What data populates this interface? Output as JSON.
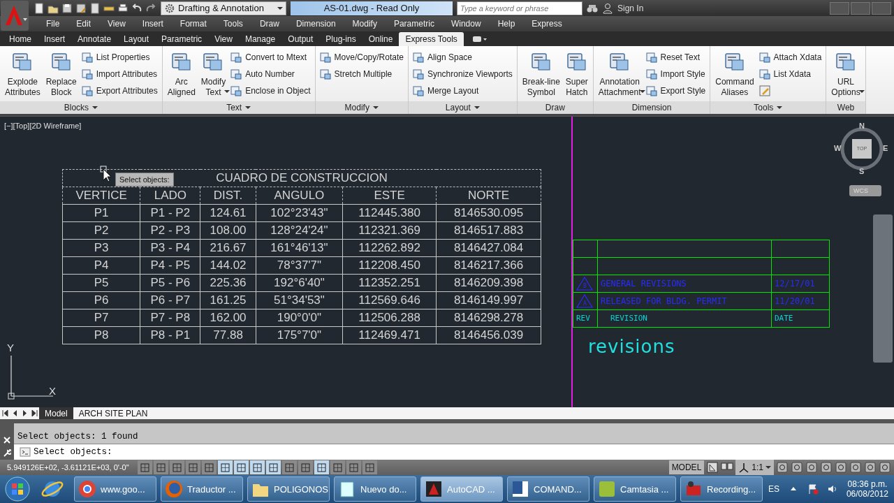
{
  "title_bar": {
    "workspace": "Drafting & Annotation",
    "title": "AS-01.dwg - Read Only",
    "search": {
      "placeholder": "Type a keyword or phrase"
    },
    "sign_in": "Sign In"
  },
  "menu": [
    "File",
    "Edit",
    "View",
    "Insert",
    "Format",
    "Tools",
    "Draw",
    "Dimension",
    "Modify",
    "Parametric",
    "Window",
    "Help",
    "Express"
  ],
  "ribbon_tabs": [
    {
      "label": "Home",
      "selected": false
    },
    {
      "label": "Insert",
      "selected": false
    },
    {
      "label": "Annotate",
      "selected": false
    },
    {
      "label": "Layout",
      "selected": false
    },
    {
      "label": "Parametric",
      "selected": false
    },
    {
      "label": "View",
      "selected": false
    },
    {
      "label": "Manage",
      "selected": false
    },
    {
      "label": "Output",
      "selected": false
    },
    {
      "label": "Plug-ins",
      "selected": false
    },
    {
      "label": "Online",
      "selected": false
    },
    {
      "label": "Express Tools",
      "selected": true
    }
  ],
  "ribbon_panels": [
    {
      "title": "Blocks",
      "menu": true,
      "tools": [
        {
          "kind": "large",
          "label": "Explode\nAttributes"
        },
        {
          "kind": "large",
          "label": "Replace\nBlock"
        },
        {
          "kind": "small",
          "label": "List Properties"
        },
        {
          "kind": "small",
          "label": "Import Attributes"
        },
        {
          "kind": "small",
          "label": "Export Attributes"
        }
      ]
    },
    {
      "title": "Text",
      "menu": true,
      "tools": [
        {
          "kind": "large",
          "label": "Arc\nAligned"
        },
        {
          "kind": "large",
          "label": "Modify\nText",
          "dropdown": true
        },
        {
          "kind": "small",
          "label": "Convert to Mtext"
        },
        {
          "kind": "small",
          "label": "Auto Number"
        },
        {
          "kind": "small",
          "label": "Enclose in Object"
        }
      ]
    },
    {
      "title": "Modify",
      "menu": true,
      "tools": [
        {
          "kind": "small",
          "label": "Move/Copy/Rotate"
        },
        {
          "kind": "small",
          "label": "Stretch Multiple"
        }
      ]
    },
    {
      "title": "Layout",
      "menu": true,
      "tools": [
        {
          "kind": "small",
          "label": "Align Space"
        },
        {
          "kind": "small",
          "label": "Synchronize Viewports"
        },
        {
          "kind": "small",
          "label": "Merge Layout"
        }
      ]
    },
    {
      "title": "Draw",
      "menu": false,
      "tools": [
        {
          "kind": "large",
          "label": "Break-line\nSymbol"
        },
        {
          "kind": "large",
          "label": "Super\nHatch"
        }
      ]
    },
    {
      "title": "Dimension",
      "menu": false,
      "tools": [
        {
          "kind": "large",
          "label": "Annotation\nAttachment",
          "dropdown": true
        },
        {
          "kind": "small",
          "label": "Reset Text"
        },
        {
          "kind": "small",
          "label": "Import Style"
        },
        {
          "kind": "small",
          "label": "Export Style"
        }
      ]
    },
    {
      "title": "Tools",
      "menu": true,
      "tools": [
        {
          "kind": "large",
          "label": "Command\nAliases"
        },
        {
          "kind": "small",
          "label": "Attach Xdata"
        },
        {
          "kind": "small",
          "label": "List Xdata"
        },
        {
          "kind": "icon"
        }
      ]
    },
    {
      "title": "Web",
      "menu": false,
      "tools": [
        {
          "kind": "large",
          "label": "URL\nOptions",
          "dropdown": true
        }
      ]
    }
  ],
  "viewport": {
    "label": "[−][Top][2D Wireframe]",
    "tooltip": "Select objects:",
    "ucs": {
      "y": "Y",
      "x": "X"
    }
  },
  "table": {
    "selected": true,
    "title": "CUADRO DE CONSTRUCCION",
    "columns": [
      "VERTICE",
      "LADO",
      "DIST.",
      "ANGULO",
      "ESTE",
      "NORTE"
    ],
    "rows": [
      [
        "P1",
        "P1 - P2",
        "124.61",
        "102°23'43\"",
        "112445.380",
        "8146530.095"
      ],
      [
        "P2",
        "P2 - P3",
        "108.00",
        "128°24'24\"",
        "112321.369",
        "8146517.883"
      ],
      [
        "P3",
        "P3 - P4",
        "216.67",
        "161°46'13\"",
        "112262.892",
        "8146427.084"
      ],
      [
        "P4",
        "P4 - P5",
        "144.02",
        "78°37'7\"",
        "112208.450",
        "8146217.366"
      ],
      [
        "P5",
        "P5 - P6",
        "225.36",
        "192°6'40\"",
        "112352.251",
        "8146209.398"
      ],
      [
        "P6",
        "P6 - P7",
        "161.25",
        "51°34'53\"",
        "112569.646",
        "8146149.997"
      ],
      [
        "P7",
        "P7 - P8",
        "162.00",
        "190°0'0\"",
        "112506.288",
        "8146298.278"
      ],
      [
        "P8",
        "P8 - P1",
        "77.88",
        "175°7'0\"",
        "112469.471",
        "8146456.039"
      ]
    ]
  },
  "view_cube": {
    "north": "N",
    "west": "W",
    "east": "E",
    "south": "S",
    "face": "TOP",
    "ucs_menu": "WCS"
  },
  "revision_table": {
    "rows": [
      {
        "kind": "blank"
      },
      {
        "kind": "blank"
      },
      {
        "kind": "revision",
        "rev": "B",
        "description": "GENERAL REVISIONS",
        "date": "12/17/01"
      },
      {
        "kind": "revision",
        "rev": "A",
        "description": "RELEASED FOR BLDG. PERMIT",
        "date": "11/20/01"
      }
    ],
    "header": {
      "rev": "REV",
      "description": "REVISION",
      "date": "DATE"
    },
    "caption": "revisions"
  },
  "layout_tabs": [
    {
      "label": "Model",
      "selected": true
    },
    {
      "label": "ARCH SITE PLAN",
      "selected": false
    }
  ],
  "command_line": {
    "history": "Select objects: 1 found",
    "prompt": "Select objects:"
  },
  "status_bar": {
    "coordinates": "5.949126E+02, -3.61121E+03, 0'-0\"",
    "toggles": [
      {
        "on": false
      },
      {
        "on": false
      },
      {
        "on": false
      },
      {
        "on": false
      },
      {
        "on": false
      },
      {
        "on": true
      },
      {
        "on": true
      },
      {
        "on": true
      },
      {
        "on": true
      },
      {
        "on": false
      },
      {
        "on": false
      },
      {
        "on": true
      },
      {
        "on": false
      },
      {
        "on": false
      },
      {
        "on": false
      }
    ],
    "space": "MODEL",
    "scale": "1:1"
  },
  "taskbar": {
    "buttons": [
      {
        "label": "www.goo...",
        "selected": false
      },
      {
        "label": "Traductor ...",
        "selected": false
      },
      {
        "label": "POLIGONOS",
        "selected": false
      },
      {
        "label": "Nuevo do...",
        "selected": false
      },
      {
        "label": "AutoCAD ...",
        "selected": true
      },
      {
        "label": "COMAND...",
        "selected": false
      },
      {
        "label": "Camtasia ...",
        "selected": false
      },
      {
        "label": "Recording...",
        "selected": false
      }
    ],
    "language": "ES",
    "time": "08:36 p.m.",
    "date": "06/08/2012"
  }
}
